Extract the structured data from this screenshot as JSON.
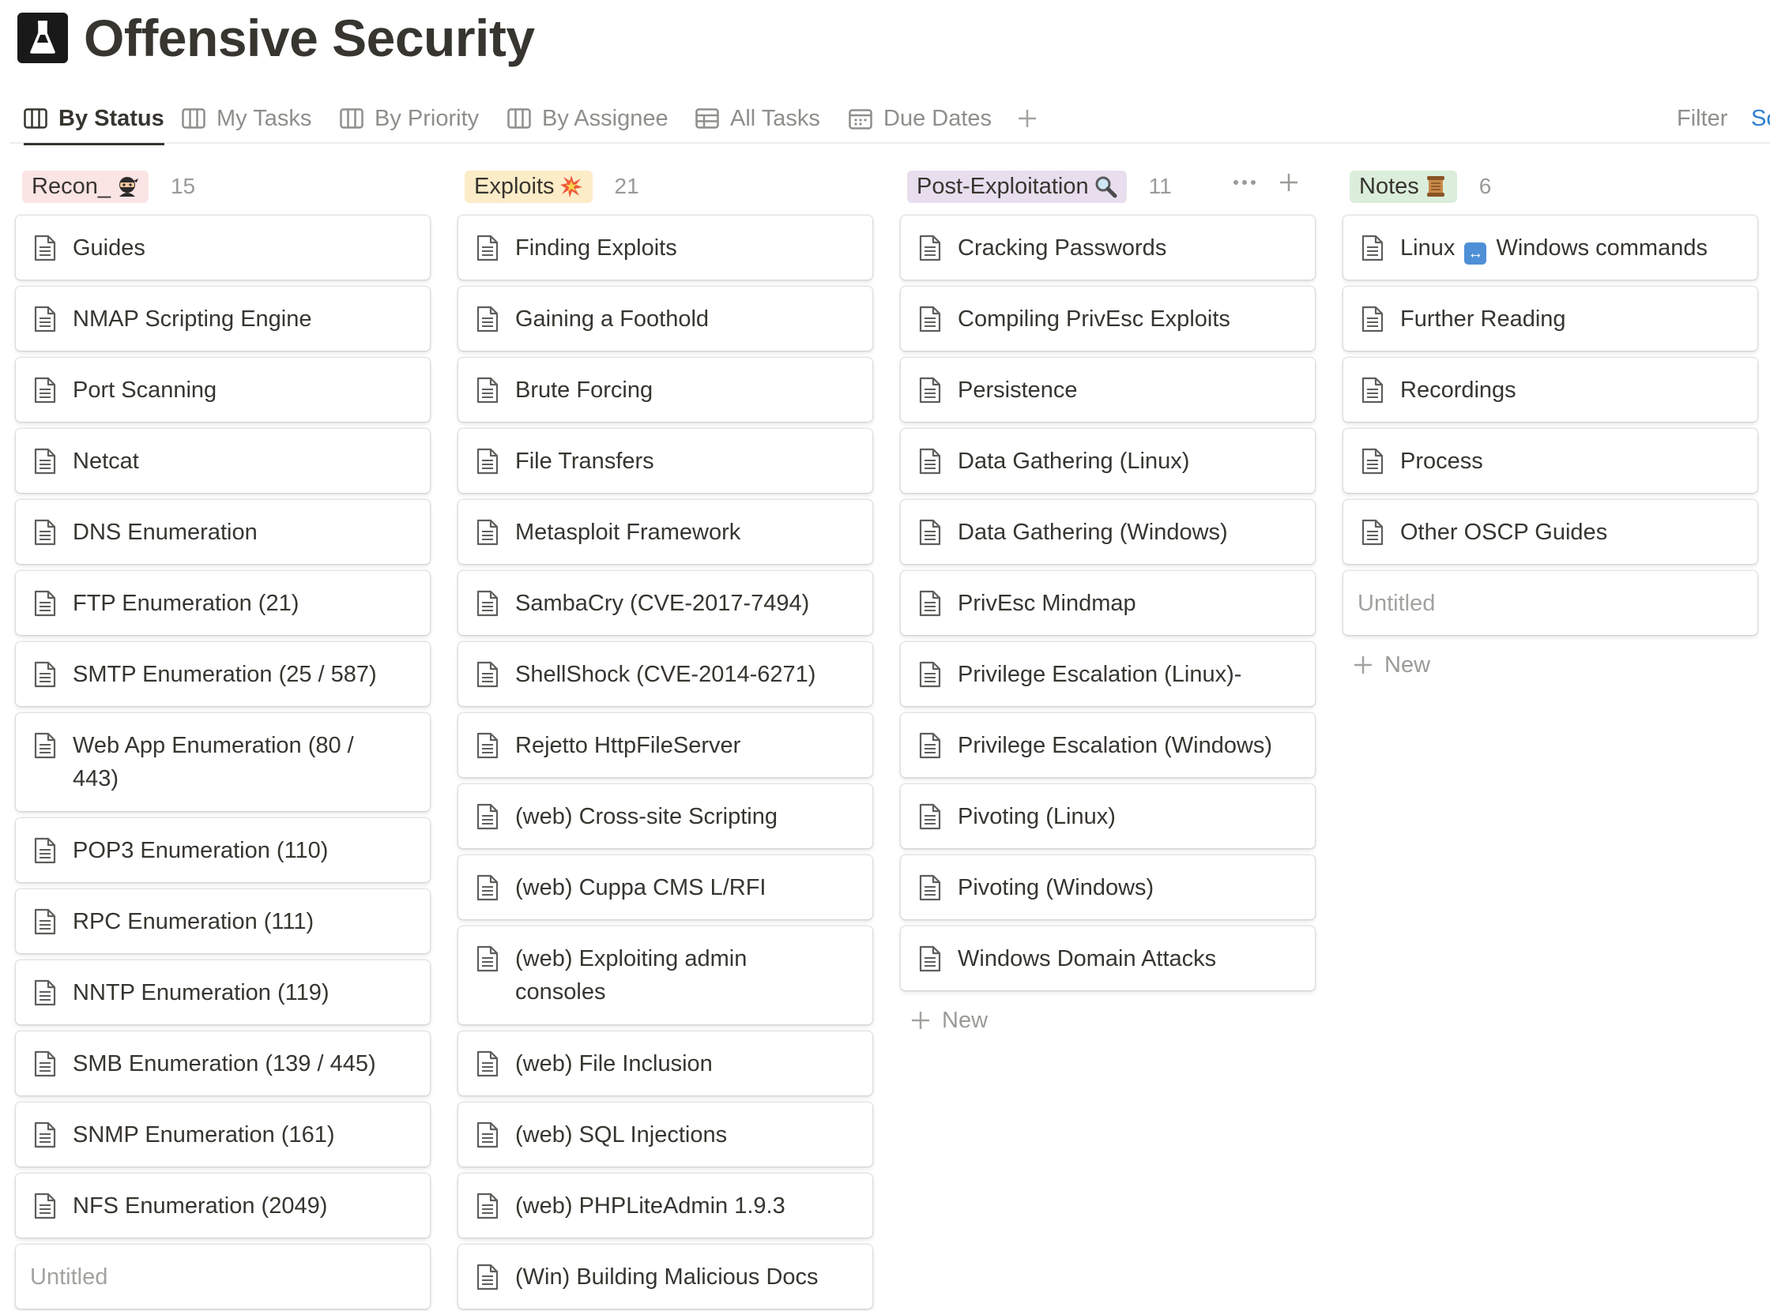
{
  "page": {
    "title": "Offensive Security",
    "icon": "flask-icon"
  },
  "tabs": [
    {
      "label": "By Status",
      "icon": "board-icon",
      "active": true
    },
    {
      "label": "My Tasks",
      "icon": "board-icon"
    },
    {
      "label": "By Priority",
      "icon": "board-icon"
    },
    {
      "label": "By Assignee",
      "icon": "board-icon"
    },
    {
      "label": "All Tasks",
      "icon": "table-icon"
    },
    {
      "label": "Due Dates",
      "icon": "calendar-icon"
    }
  ],
  "toolbar": {
    "filter_label": "Filter",
    "sort_label": "Sort"
  },
  "colors": {
    "recon_tag_bg": "#fbe4e4",
    "exploits_tag_bg": "#fdecc8",
    "post_tag_bg": "#e8deee",
    "notes_tag_bg": "#dbeddb",
    "accent_blue": "#2f80d1"
  },
  "columns": [
    {
      "name": "Recon_",
      "emoji": "ninja",
      "count": "15",
      "cards": [
        "Guides",
        "NMAP Scripting Engine",
        "Port Scanning",
        "Netcat",
        "DNS Enumeration",
        "FTP Enumeration (21)",
        "SMTP Enumeration (25 / 587)",
        "Web App Enumeration (80 /\n443)",
        "POP3 Enumeration (110)",
        "RPC Enumeration (111)",
        "NNTP Enumeration (119)",
        "SMB Enumeration (139 / 445)",
        "SNMP Enumeration (161)",
        "NFS Enumeration (2049)"
      ],
      "untitled": "Untitled"
    },
    {
      "name": "Exploits",
      "emoji": "explosion",
      "count": "21",
      "cards": [
        "Finding Exploits",
        "Gaining a Foothold",
        "Brute Forcing",
        "File Transfers",
        "Metasploit Framework",
        "SambaCry (CVE-2017-7494)",
        "ShellShock (CVE-2014-6271)",
        "Rejetto HttpFileServer",
        "(web) Cross-site Scripting",
        "(web) Cuppa CMS L/RFI",
        "(web) Exploiting admin\nconsoles",
        "(web) File Inclusion",
        "(web) SQL Injections",
        "(web) PHPLiteAdmin 1.9.3",
        "(Win) Building Malicious Docs"
      ]
    },
    {
      "name": "Post-Exploitation",
      "emoji": "magnifier",
      "count": "11",
      "cards": [
        "Cracking Passwords",
        "Compiling PrivEsc Exploits",
        "Persistence",
        "Data Gathering (Linux)",
        "Data Gathering (Windows)",
        "PrivEsc Mindmap",
        "Privilege Escalation (Linux)-",
        "Privilege Escalation (Windows)",
        "Pivoting (Linux)",
        "Pivoting (Windows)",
        "Windows Domain Attacks"
      ],
      "new_label": "New"
    },
    {
      "name": "Notes",
      "emoji": "scroll",
      "count": "6",
      "cards": [
        "Linux ↔ Windows commands",
        "Further Reading",
        "Recordings",
        "Process",
        "Other OSCP Guides"
      ],
      "untitled": "Untitled",
      "new_label": "New"
    }
  ]
}
